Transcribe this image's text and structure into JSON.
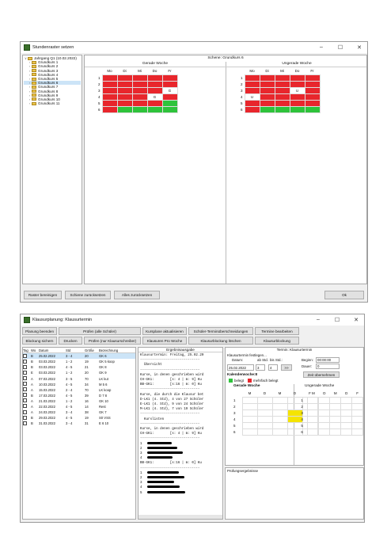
{
  "win1": {
    "title": "Stundenraster setzen",
    "tree": {
      "root": "Jahrgang Q1 (10.02.2022)",
      "items": [
        "Grundkurs 1",
        "Grundkurs 2",
        "Grundkurs 3",
        "Grundkurs 4",
        "Grundkurs 5",
        "Grundkurs 6",
        "Grundkurs 7",
        "Grundkurs 8",
        "Grundkurs 9",
        "Grundkurs 10",
        "Grundkurs 11"
      ],
      "selected_index": 5
    },
    "schene_label": "Schene: Grundkurs 6",
    "even": {
      "title": "Gerade Woche",
      "days": [
        "Mo",
        "Di",
        "Mi",
        "Do",
        "Fr"
      ],
      "rows": [
        "1",
        "2",
        "3",
        "4",
        "5",
        "6"
      ]
    },
    "odd": {
      "title": "Ungerade Woche",
      "days": [
        "Mo",
        "Di",
        "Mi",
        "Do",
        "Fr"
      ],
      "rows": [
        "1",
        "2",
        "3",
        "4",
        "5",
        "6"
      ]
    },
    "even_cells": [
      [
        "r",
        "r",
        "r",
        "r",
        "r"
      ],
      [
        "r",
        "r",
        "r",
        "r",
        "r"
      ],
      [
        "r",
        "r",
        "r",
        "r",
        "w:G"
      ],
      [
        "r",
        "r",
        "r",
        "w:G",
        "r"
      ],
      [
        "r",
        "r",
        "r",
        "r",
        "g"
      ],
      [
        "r",
        "g",
        "g",
        "g",
        "g"
      ]
    ],
    "odd_cells": [
      [
        "r",
        "r",
        "r",
        "r",
        "r"
      ],
      [
        "r",
        "r",
        "r",
        "r",
        "r"
      ],
      [
        "r",
        "r",
        "r",
        "w:U",
        "r"
      ],
      [
        "w:U",
        "r",
        "r",
        "r",
        "r"
      ],
      [
        "r",
        "r",
        "r",
        "r",
        "r"
      ],
      [
        "r",
        "g",
        "g",
        "g",
        "g"
      ]
    ],
    "buttons": {
      "b1": "Raster bereinigen",
      "b2": "Schiene zurücksetzen",
      "b3": "Alles zurücksetzen",
      "ok": "Ok"
    }
  },
  "win2": {
    "title": "Klausurplanung: Klausurtermin",
    "toolbar": {
      "row1": [
        "Planung beenden",
        "Prüfen (alle Schüler)",
        "Kursplane aktualisieren",
        "Schüler-Terminüberschneidungen",
        "Termine bearbeiten"
      ],
      "row2": [
        "Blockung sichern",
        "Drucken",
        "Prüfen (nur Klausurschreiber)",
        "Klausuren Pro Woche",
        "Klausurblockung löschen",
        "Klausurblockung"
      ]
    },
    "list_headers": [
      "Tag",
      "Wo",
      "Datum",
      "Std",
      "Größe",
      "Bezeichnung"
    ],
    "list_rows": [
      [
        "I",
        "B",
        "25.02.2022",
        "3 - 4",
        "20",
        "GK 6"
      ],
      [
        "I",
        "B",
        "03.03.2022",
        "1 - 2",
        "19",
        "GK 5 koop"
      ],
      [
        "I",
        "B",
        "03.03.2022",
        "4 - 5",
        "21",
        "GK 8"
      ],
      [
        "I",
        "E",
        "03.03.2022",
        "1 - 2",
        "20",
        "GK 9"
      ],
      [
        "I",
        "A",
        "07.03.2022",
        "3 - 5",
        "70",
        "LK kut"
      ],
      [
        "I",
        "A",
        "10.03.2022",
        "4 - 5",
        "34",
        "M 5 6"
      ],
      [
        "I",
        "A",
        "15.03.2022",
        "2 - 4",
        "70",
        "LK koop"
      ],
      [
        "I",
        "B",
        "17.03.2022",
        "4 - 5",
        "39",
        "D 7 8"
      ],
      [
        "I",
        "A",
        "21.03.2022",
        "1 - 2",
        "16",
        "GK 10"
      ],
      [
        "I",
        "A",
        "22.03.2022",
        "4 - 5",
        "14",
        "Rest"
      ],
      [
        "I",
        "A",
        "24.03.2022",
        "3 - 4",
        "38",
        "GK 7"
      ],
      [
        "I",
        "B",
        "29.03.2022",
        "4 - 5",
        "19",
        "S0 VSS"
      ],
      [
        "I",
        "B",
        "31.03.2022",
        "3 - 4",
        "31",
        "E 6 10"
      ]
    ],
    "ergebnis": {
      "title": "Ergebnisausgabe",
      "lines": [
        "Klausurtermin: Freitag, 25.02.20",
        "------------------------------",
        "  Übersicht",
        "------------------------------",
        "Kurse, in denen geschrieben wird",
        "",
        "CH-GK1:        [s: 4 | m: 9] Ku",
        "BB-GK1:        [s:16 | m: 0] Ku",
        "",
        "------------------------------",
        "Kurse, die durch die Klausur bet",
        "",
        "D-LK1 (4. Std), 4 von 27 Schüler",
        "E-LK1 (4. Std), 9 von 24 Schüler",
        "M-LK1 (4. Std), 7 von 19 Schüler",
        "",
        "------------------------------",
        "  Kurslisten",
        "------------------------------",
        "Kurse, in denen geschrieben wird",
        "",
        "CH-GK1:        [s: 4 | m: 9] Ku",
        "------------------------------",
        "1",
        "2",
        "3",
        "4",
        "",
        "BB-GK1:        [s:16 | m: 0] Ku",
        "------------------------------",
        "1",
        "2",
        "3",
        "4",
        "5"
      ]
    },
    "termin": {
      "title": "Termin: Klausurtermin",
      "festlegen": "Klausurtermin festlegen...",
      "datum_label": "Datum:",
      "abstd_label": "ab Std.",
      "bisstd_label": "bis Std.:",
      "datum": "25.02.2022",
      "ab": "3",
      "bis": "4",
      "next": ">>",
      "beginn_label": "Beginn:",
      "beginn": "00:00:00",
      "dauer_label": "Dauer:",
      "dauer": "0",
      "zeit_btn": "Zeit übernehmen",
      "kw": "Kalenderwoche:8",
      "legend_belegt": "belegt",
      "legend_mehrfach": "mehrfach belegt",
      "gerade": "Gerade Woche",
      "ungerade": "Ungerade Woche",
      "days": [
        "M",
        "D",
        "M",
        "D",
        "F"
      ],
      "rows": [
        "1",
        "2",
        "3",
        "4",
        "5",
        "6"
      ]
    },
    "pruef_title": "Prüfungsergebnisse",
    "colors": {
      "belegt": "#2ec33b",
      "mehrfach": "#e8262c",
      "highlight": "#f5e400"
    }
  }
}
